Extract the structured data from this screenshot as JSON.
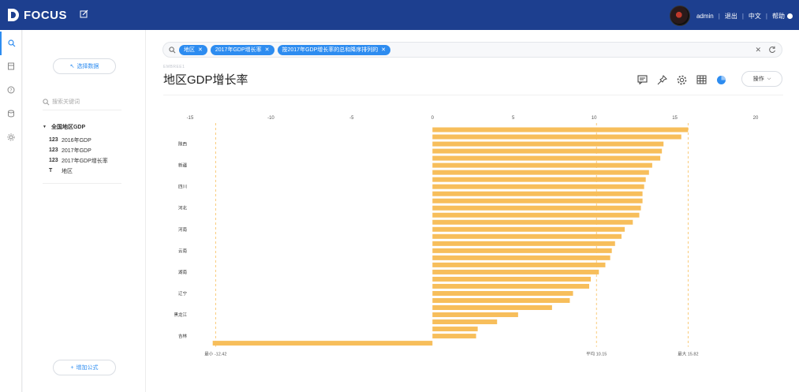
{
  "app": {
    "name": "FOCUS",
    "user": "admin",
    "logout": "退出",
    "language": "中文",
    "help": "帮助"
  },
  "sidebar": {
    "select_data": "选择数据",
    "search_placeholder": "搜索关键词",
    "tree": {
      "root": "全国地区GDP",
      "items": [
        {
          "type": "123",
          "label": "2016年GDP"
        },
        {
          "type": "123",
          "label": "2017年GDP"
        },
        {
          "type": "123",
          "label": "2017年GDP增长率"
        },
        {
          "type": "T",
          "label": "地区"
        }
      ]
    },
    "add_formula": "增加公式"
  },
  "filter": {
    "chips": [
      "地区",
      "2017年GDP增长率",
      "按2017年GDP增长率的总和降序排列的"
    ]
  },
  "main": {
    "breadcrumb": "EMBREE1",
    "title": "地区GDP增长率",
    "operate": "操作"
  },
  "colors": {
    "accent": "#2d8cf0",
    "bar": "#f7be5b",
    "header": "#1d3f8f"
  },
  "icons": [
    "search-icon",
    "edit-icon",
    "comment-icon",
    "pin-icon",
    "gear-icon",
    "table-icon",
    "pie-chart-icon",
    "refresh-icon"
  ],
  "chart_data": {
    "type": "bar",
    "orientation": "horizontal",
    "xlim": [
      -15,
      20
    ],
    "xticks": [
      -15,
      -10,
      -5,
      0,
      5,
      10,
      15,
      20
    ],
    "category_labels": [
      "陕西",
      "新疆",
      "四川",
      "河北",
      "河南",
      "云南",
      "湖南",
      "辽宁",
      "黑龙江",
      "吉林"
    ],
    "values": [
      15.82,
      15.4,
      14.3,
      14.2,
      14.1,
      13.6,
      13.4,
      13.2,
      13.1,
      13.0,
      13.0,
      12.9,
      12.8,
      12.4,
      11.9,
      11.7,
      11.3,
      11.1,
      11.0,
      10.7,
      10.3,
      9.8,
      9.7,
      8.7,
      8.5,
      7.4,
      5.3,
      4.0,
      2.8,
      2.7,
      -13.6
    ],
    "reference_lines": [
      {
        "label": "最小 -12.42",
        "value": -13.42
      },
      {
        "label": "平均 10.15",
        "value": 10.15
      },
      {
        "label": "最大 15.82",
        "value": 15.82
      }
    ]
  }
}
